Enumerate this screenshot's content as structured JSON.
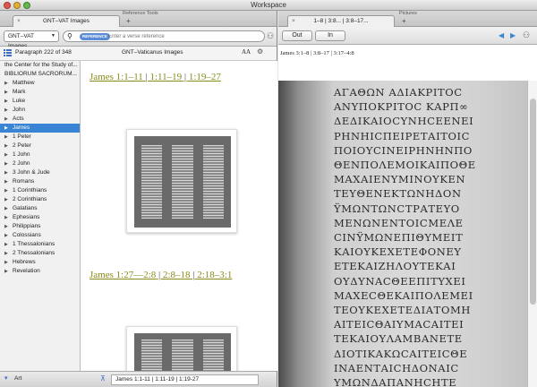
{
  "window": {
    "title": "Workspace"
  },
  "left": {
    "panel_label": "Reference Tools",
    "tab_label": "GNT–VAT Images",
    "resource_dropdown": "GNT–VAT Images",
    "search_chip": "REFERENCE",
    "search_placeholder": "Enter a verse reference",
    "paragraph_info": "Paragraph 222 of 348",
    "resource_title": "GNT–Vaticanus Images",
    "font_size_icon": "AA",
    "sidebar_items": [
      {
        "label": "the Center for the Study of...",
        "type": "head"
      },
      {
        "label": "BIBLIORUM SACRORUM...",
        "type": "head"
      },
      {
        "label": "Matthew"
      },
      {
        "label": "Mark"
      },
      {
        "label": "Luke"
      },
      {
        "label": "John"
      },
      {
        "label": "Acts"
      },
      {
        "label": "James",
        "selected": true
      },
      {
        "label": "1 Peter"
      },
      {
        "label": "2 Peter"
      },
      {
        "label": "1 John"
      },
      {
        "label": "2 John"
      },
      {
        "label": "3 John & Jude"
      },
      {
        "label": "Romans"
      },
      {
        "label": "1 Corinthians"
      },
      {
        "label": "2 Corinthians"
      },
      {
        "label": "Galatians"
      },
      {
        "label": "Ephesians"
      },
      {
        "label": "Philippians"
      },
      {
        "label": "Colossians"
      },
      {
        "label": "1 Thessalonians"
      },
      {
        "label": "2 Thessalonians"
      },
      {
        "label": "Hebrews"
      },
      {
        "label": "Revelation"
      }
    ],
    "refs1": [
      "James 1:1–11",
      "1:11–19",
      "1:19–27"
    ],
    "refs2": [
      "James 1:27—2:8",
      "2:8–18",
      "2:18–3:1"
    ],
    "bottom_dropdown": "Art",
    "nav_field": "James 1:1-11  |  1:11-19  |  1:19-27"
  },
  "right": {
    "panel_label": "Pictures",
    "tab_label": "1–8 |  3:8... |  3:8–17...",
    "out_label": "Out",
    "in_label": "In",
    "ref_line": "James 3:1–8 | 3:8–17 | 3:17–4:8",
    "manuscript_lines": [
      "ΑΓΑΘΩΝ ΑΔΙΑΚΡΙΤΟC",
      "ΑΝΥΠΟΚΡΙΤΟC ΚΑΡΠ∞",
      "ΔΕΔΙΚΑΙΟCΥΝΗCΕΕΝΕΙ",
      "ΡΗΝΗΙCΠΕΙΡΕΤΑΙΤΟΙC",
      "ΠΟΙΟΥCΙΝΕΙΡΗΝΗΝΠΟ",
      "ΘΕΝΠΟΛΕΜΟΙΚΑΙΠΟΘΕ",
      "ΜΑΧΑΙΕΝΥΜΙΝΟΥΚΕΝ",
      "ΤΕΥΘΕΝΕΚΤΩΝΗΔΟΝ",
      "ŸΜΩΝΤΩΝCΤΡΑΤΕΥΟ",
      "ΜΕΝΩΝΕΝΤΟΙCΜΕΛΕ",
      "CΙΝΫΜΩΝΕΠΙΘΥΜΕΙΤ",
      "ΚΑΙΟΥΚΕΧΕΤΕΦΟΝΕΥ",
      "ΕΤΕΚΑΙΖΗΛΟΥΤΕΚΑΙ",
      "ΟΥΔΥΝΑCΘΕΕΠΙΤΥΧΕΙ",
      "ΜΑΧΕCΘΕΚΑΙΠΟΛΕΜΕΙ",
      "ΤΕΟΥΚΕΧΕΤΕΔΙΑΤΟΜΗ",
      "ΑΙΤΕΙCΘΑΙΥΜΑCΑΙΤΕΙ",
      "ΤΕΚΑΙΟΥΛΑΜΒΑΝΕΤΕ",
      "ΔΙΟΤΙΚΑΚΩCΑΙΤΕΙCΘΕ",
      "ΙΝΑΕΝΤΑΙCΗΔΟΝΑΙC",
      "ΥΜΩΝΔΑΠΑΝΗCΗΤΕ"
    ]
  },
  "colors": {
    "selection": "#3a84d6",
    "link_olive": "#8a8a1a"
  }
}
